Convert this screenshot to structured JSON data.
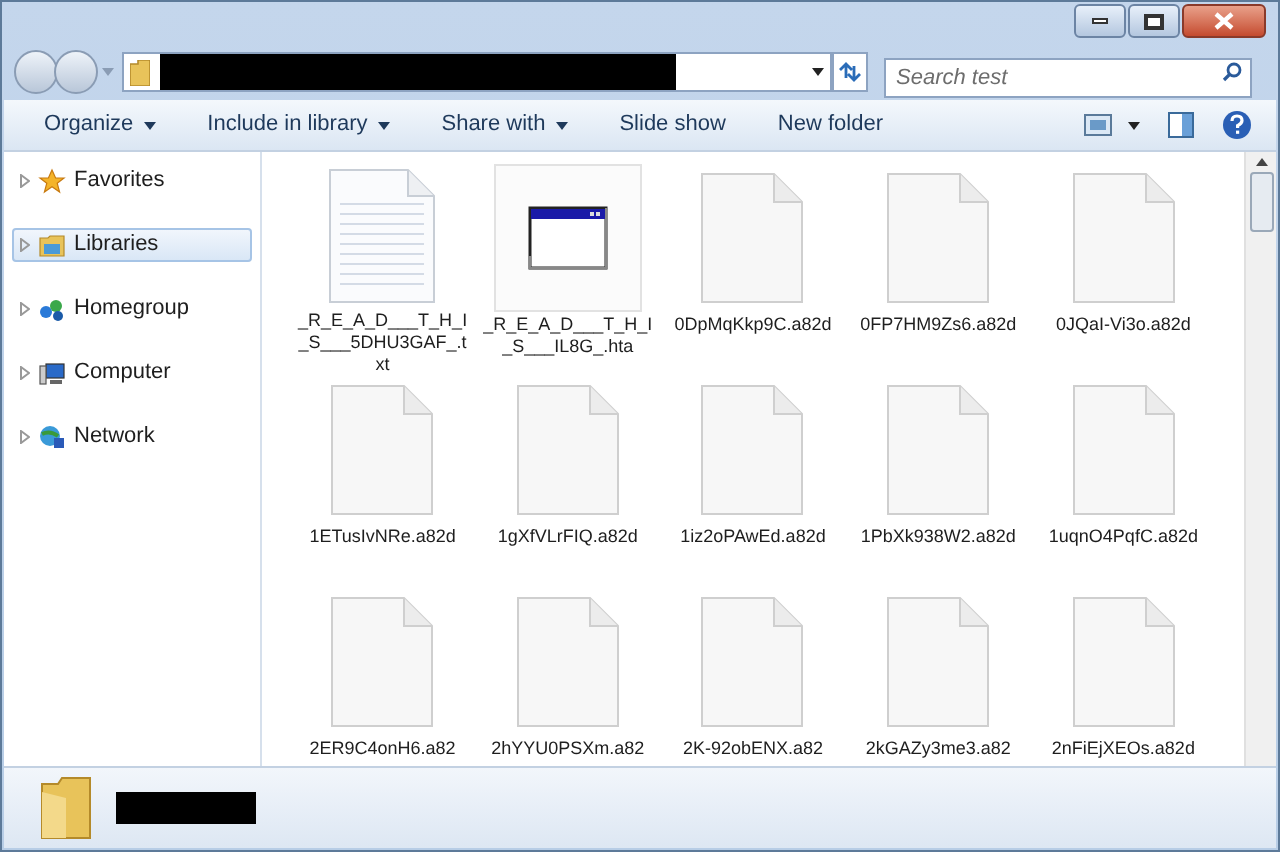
{
  "search": {
    "placeholder": "Search test"
  },
  "toolbar": [
    {
      "label": "Organize",
      "dropdown": true
    },
    {
      "label": "Include in library",
      "dropdown": true
    },
    {
      "label": "Share with",
      "dropdown": true
    },
    {
      "label": "Slide show",
      "dropdown": false
    },
    {
      "label": "New folder",
      "dropdown": false
    }
  ],
  "sidebar": {
    "items": [
      {
        "label": "Favorites",
        "kind": "favorites",
        "selected": false
      },
      {
        "label": "Libraries",
        "kind": "libraries",
        "selected": true
      },
      {
        "label": "Homegroup",
        "kind": "homegroup",
        "selected": false
      },
      {
        "label": "Computer",
        "kind": "computer",
        "selected": false
      },
      {
        "label": "Network",
        "kind": "network",
        "selected": false
      }
    ]
  },
  "files": [
    {
      "name": "_R_E_A_D___T_H_I_S___5DHU3GAF_.txt",
      "kind": "text",
      "selected": false
    },
    {
      "name": "_R_E_A_D___T_H_I_S___IL8G_.hta",
      "kind": "app",
      "selected": true
    },
    {
      "name": "0DpMqKkp9C.a82d",
      "kind": "blank",
      "selected": false
    },
    {
      "name": "0FP7HM9Zs6.a82d",
      "kind": "blank",
      "selected": false
    },
    {
      "name": "0JQaI-Vi3o.a82d",
      "kind": "blank",
      "selected": false
    },
    {
      "name": "1ETusIvNRe.a82d",
      "kind": "blank",
      "selected": false
    },
    {
      "name": "1gXfVLrFIQ.a82d",
      "kind": "blank",
      "selected": false
    },
    {
      "name": "1iz2oPAwEd.a82d",
      "kind": "blank",
      "selected": false
    },
    {
      "name": "1PbXk938W2.a82d",
      "kind": "blank",
      "selected": false
    },
    {
      "name": "1uqnO4PqfC.a82d",
      "kind": "blank",
      "selected": false
    },
    {
      "name": "2ER9C4onH6.a82",
      "kind": "blank",
      "selected": false
    },
    {
      "name": "2hYYU0PSXm.a82",
      "kind": "blank",
      "selected": false
    },
    {
      "name": "2K-92obENX.a82",
      "kind": "blank",
      "selected": false
    },
    {
      "name": "2kGAZy3me3.a82",
      "kind": "blank",
      "selected": false
    },
    {
      "name": "2nFiEjXEOs.a82d",
      "kind": "blank",
      "selected": false
    }
  ]
}
